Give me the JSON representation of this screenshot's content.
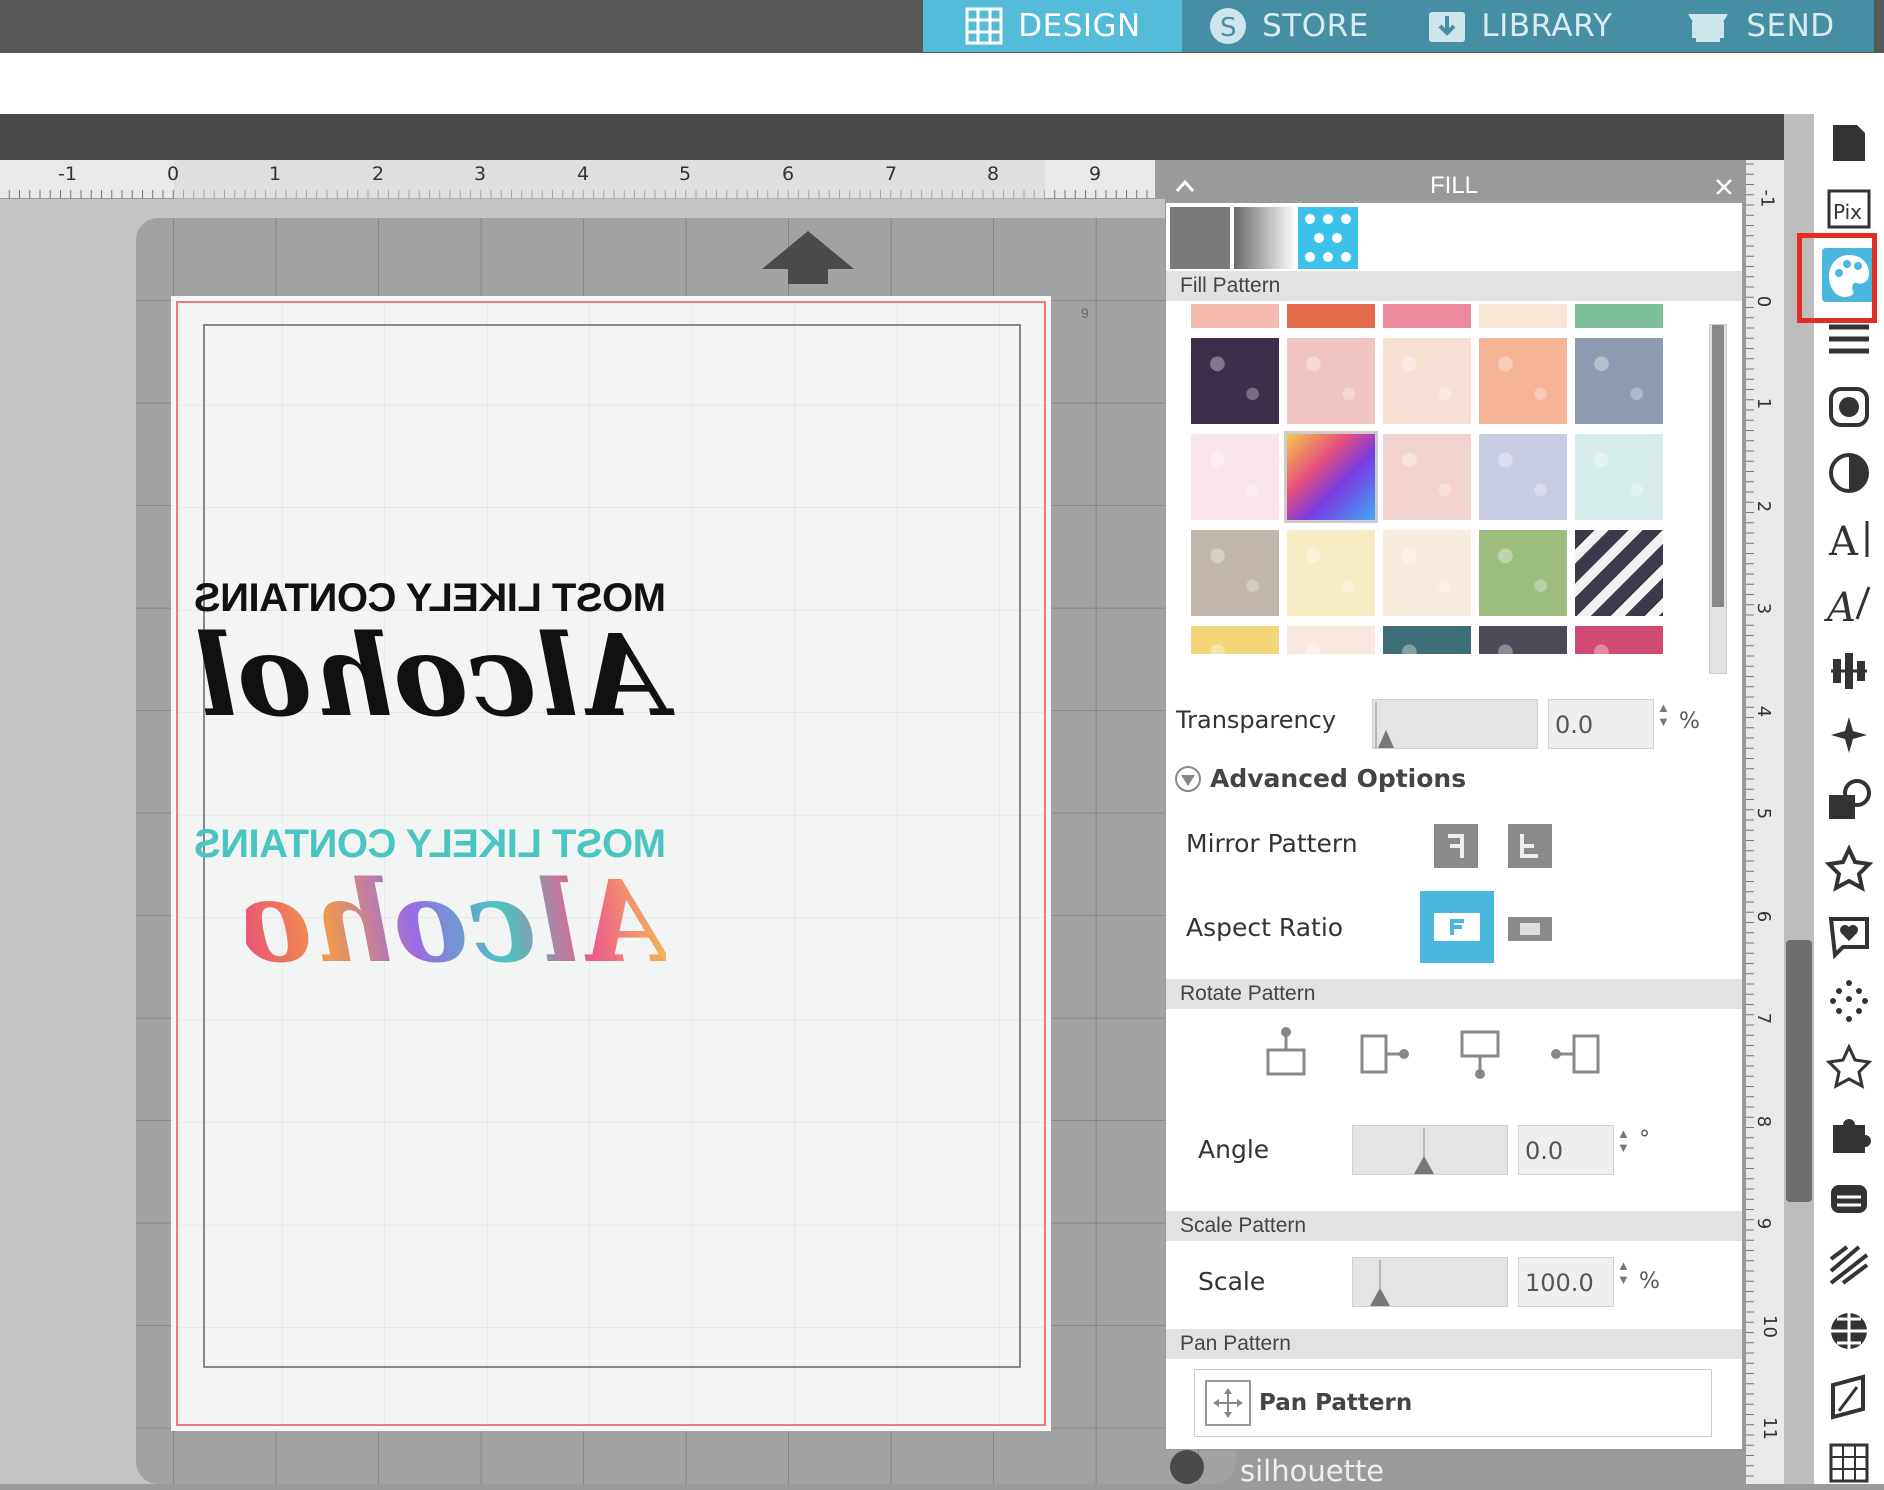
{
  "tabs": [
    {
      "label": "DESIGN",
      "icon": "grid-icon",
      "active": true
    },
    {
      "label": "STORE",
      "icon": "store-s-icon",
      "active": false
    },
    {
      "label": "LIBRARY",
      "icon": "library-download-icon",
      "active": false
    },
    {
      "label": "SEND",
      "icon": "send-printer-icon",
      "active": false
    }
  ],
  "ruler": {
    "horizontal": [
      "-1",
      "0",
      "1",
      "2",
      "3",
      "4",
      "5",
      "6",
      "7",
      "8",
      "9"
    ],
    "vertical": [
      "-1",
      "0",
      "1",
      "2",
      "3",
      "4",
      "5",
      "6",
      "7",
      "8",
      "9",
      "10",
      "11"
    ]
  },
  "canvas": {
    "mat_marker": "9",
    "design1": {
      "line1": "MOST LIKELY CONTAINS",
      "line2": "Alcohol",
      "color": "#111111"
    },
    "design2": {
      "line1": "MOST LIKELY CONTAINS",
      "line2": "Alcohol",
      "color": "#49c5c2"
    }
  },
  "fill_panel": {
    "title": "FILL",
    "fill_types": [
      "solid-fill-icon",
      "gradient-fill-icon",
      "pattern-fill-icon"
    ],
    "fill_pattern_label": "Fill Pattern",
    "patterns": [
      [
        "#f3b9ad",
        "#e46a4c",
        "#ee8aa0",
        "#f6e7d6",
        "#7dbf9a"
      ],
      [
        "#3d2f4a",
        "#f0c4c2",
        "#f6e0d4",
        "#f5b496",
        "#8f9bb0"
      ],
      [
        "#f7e4ec",
        "#c85a9a",
        "#f2d2cf",
        "#c9cde3",
        "#d6ecea"
      ],
      [
        "#c0b6ab",
        "#f5ecc4",
        "#f8ecdf",
        "#9dbd7f",
        "#3a3a4a"
      ],
      [
        "#f4d67a",
        "#f9e8df",
        "#3e6f78",
        "#4d4a57",
        "#d04b73"
      ]
    ],
    "transparency_label": "Transparency",
    "transparency_value": "0.0",
    "transparency_unit": "%",
    "advanced_label": "Advanced Options",
    "mirror_label": "Mirror Pattern",
    "aspect_label": "Aspect Ratio",
    "rotate_section": "Rotate Pattern",
    "angle_label": "Angle",
    "angle_value": "0.0",
    "angle_unit": "°",
    "scale_section": "Scale Pattern",
    "scale_label": "Scale",
    "scale_value": "100.0",
    "scale_unit": "%",
    "pan_section": "Pan Pattern",
    "pan_button": "Pan Pattern"
  },
  "logo": "silhouette",
  "right_tools": [
    "page-setup-icon",
    "pixscan-icon",
    "fill-panel-icon",
    "line-style-icon",
    "shadow-icon",
    "image-trace-icon",
    "text-style-icon",
    "sketch-icon",
    "align-icon",
    "replicate-icon",
    "modify-icon",
    "favorites-icon",
    "offset-icon",
    "rhinestone-icon",
    "star-shape-icon",
    "puzzle-icon",
    "knife-icon",
    "hatch-icon",
    "nesting-icon",
    "transform-icon",
    "grid-layout-icon"
  ]
}
